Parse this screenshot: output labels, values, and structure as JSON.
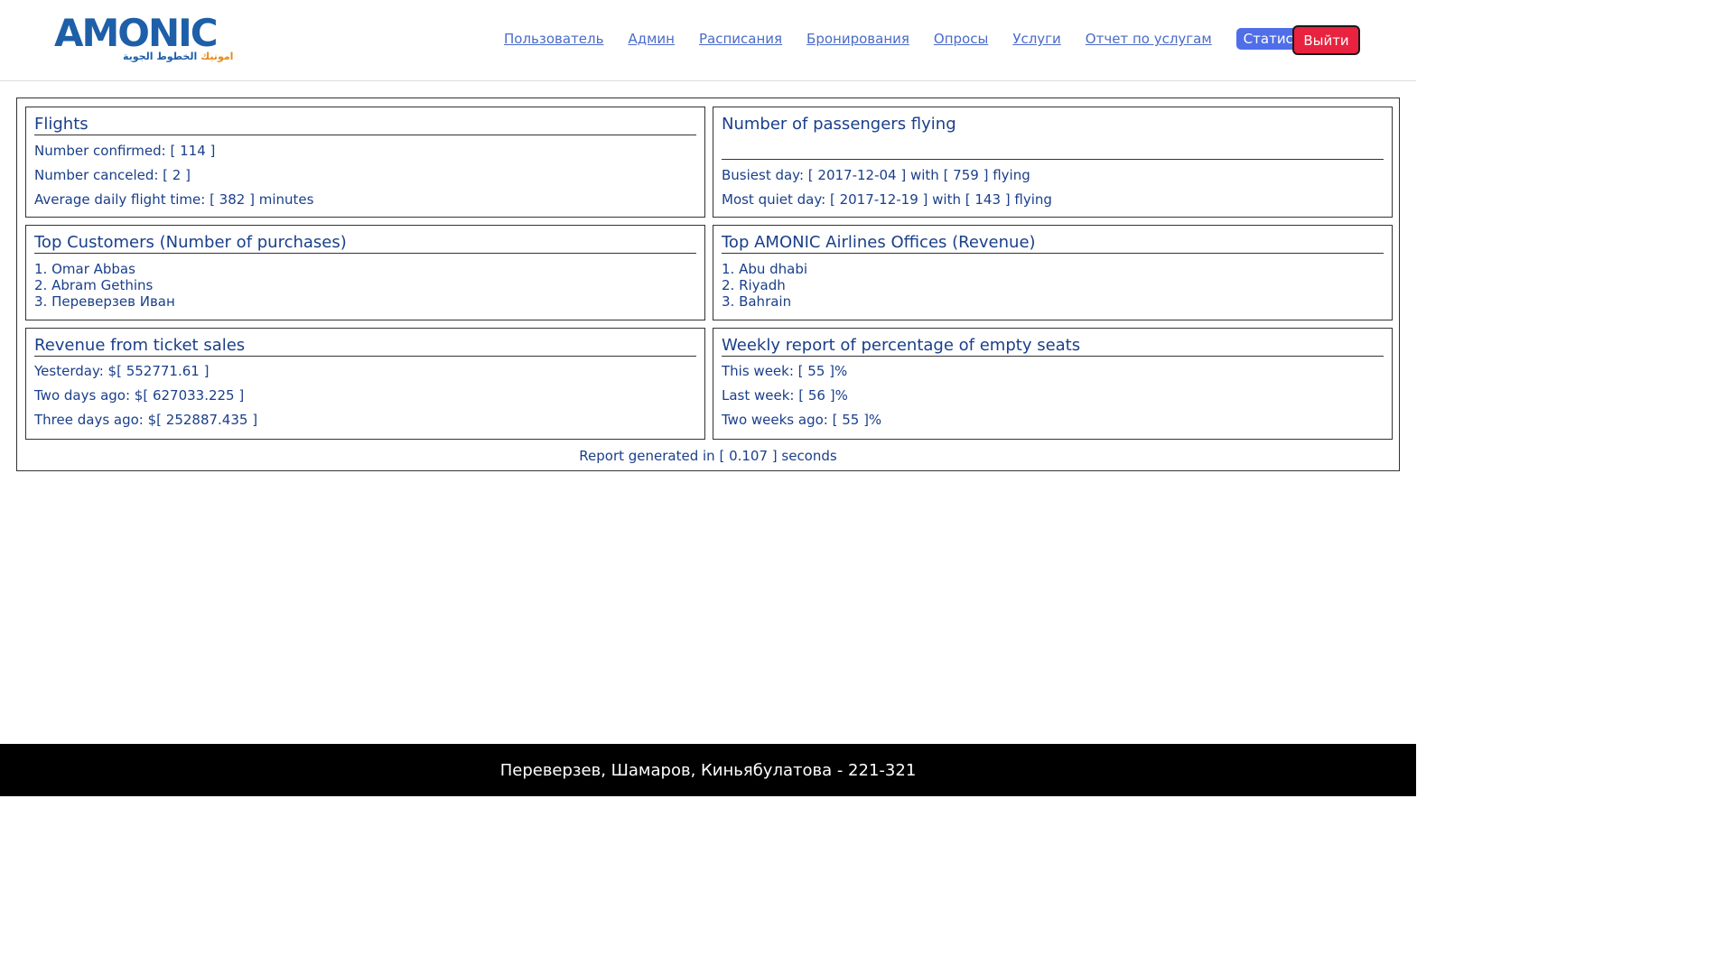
{
  "brand": {
    "logo_text": "AMONIC",
    "logo_sub_arabic_blue": "الخطوط الجوية",
    "logo_sub_arabic_orange": "امونيك",
    "accent_color": "#4f6ee8",
    "logout_color": "#e8223f"
  },
  "nav": {
    "items": [
      "Пользователь",
      "Админ",
      "Расписания",
      "Бронирования",
      "Опросы",
      "Услуги",
      "Отчет по услугам"
    ],
    "active": "Статистика",
    "logout": "Выйти"
  },
  "flights": {
    "title": "Flights",
    "confirmed": "Number confirmed: [ 114 ]",
    "canceled": "Number canceled: [ 2 ]",
    "avg_time": "Average daily flight time: [ 382 ] minutes"
  },
  "passengers": {
    "title": "Number of passengers flying",
    "busiest": "Busiest day: [ 2017-12-04 ] with [ 759 ] flying",
    "quiet": "Most quiet day: [ 2017-12-19 ] with [ 143 ] flying"
  },
  "customers": {
    "title": "Top Customers (Number of purchases)",
    "items": [
      "1. Omar Abbas",
      "2. Abram Gethins",
      "3. Переверзев Иван"
    ]
  },
  "offices": {
    "title": "Top AMONIC Airlines Offices (Revenue)",
    "items": [
      "1. Abu dhabi",
      "2. Riyadh",
      "3. Bahrain"
    ]
  },
  "revenue": {
    "title": "Revenue from ticket sales",
    "yesterday": "Yesterday: $[ 552771.61 ]",
    "two_days": "Two days ago: $[ 627033.225 ]",
    "three_days": "Three days ago: $[ 252887.435 ]"
  },
  "empty_seats": {
    "title": "Weekly report of percentage of empty seats",
    "this_week": "This week: [ 55 ]%",
    "last_week": "Last week: [ 56 ]%",
    "two_weeks": "Two weeks ago: [ 55 ]%"
  },
  "report_note": "Report generated in [ 0.107 ] seconds",
  "footer": "Переверзев, Шамаров, Киньябулатова - 221-321"
}
